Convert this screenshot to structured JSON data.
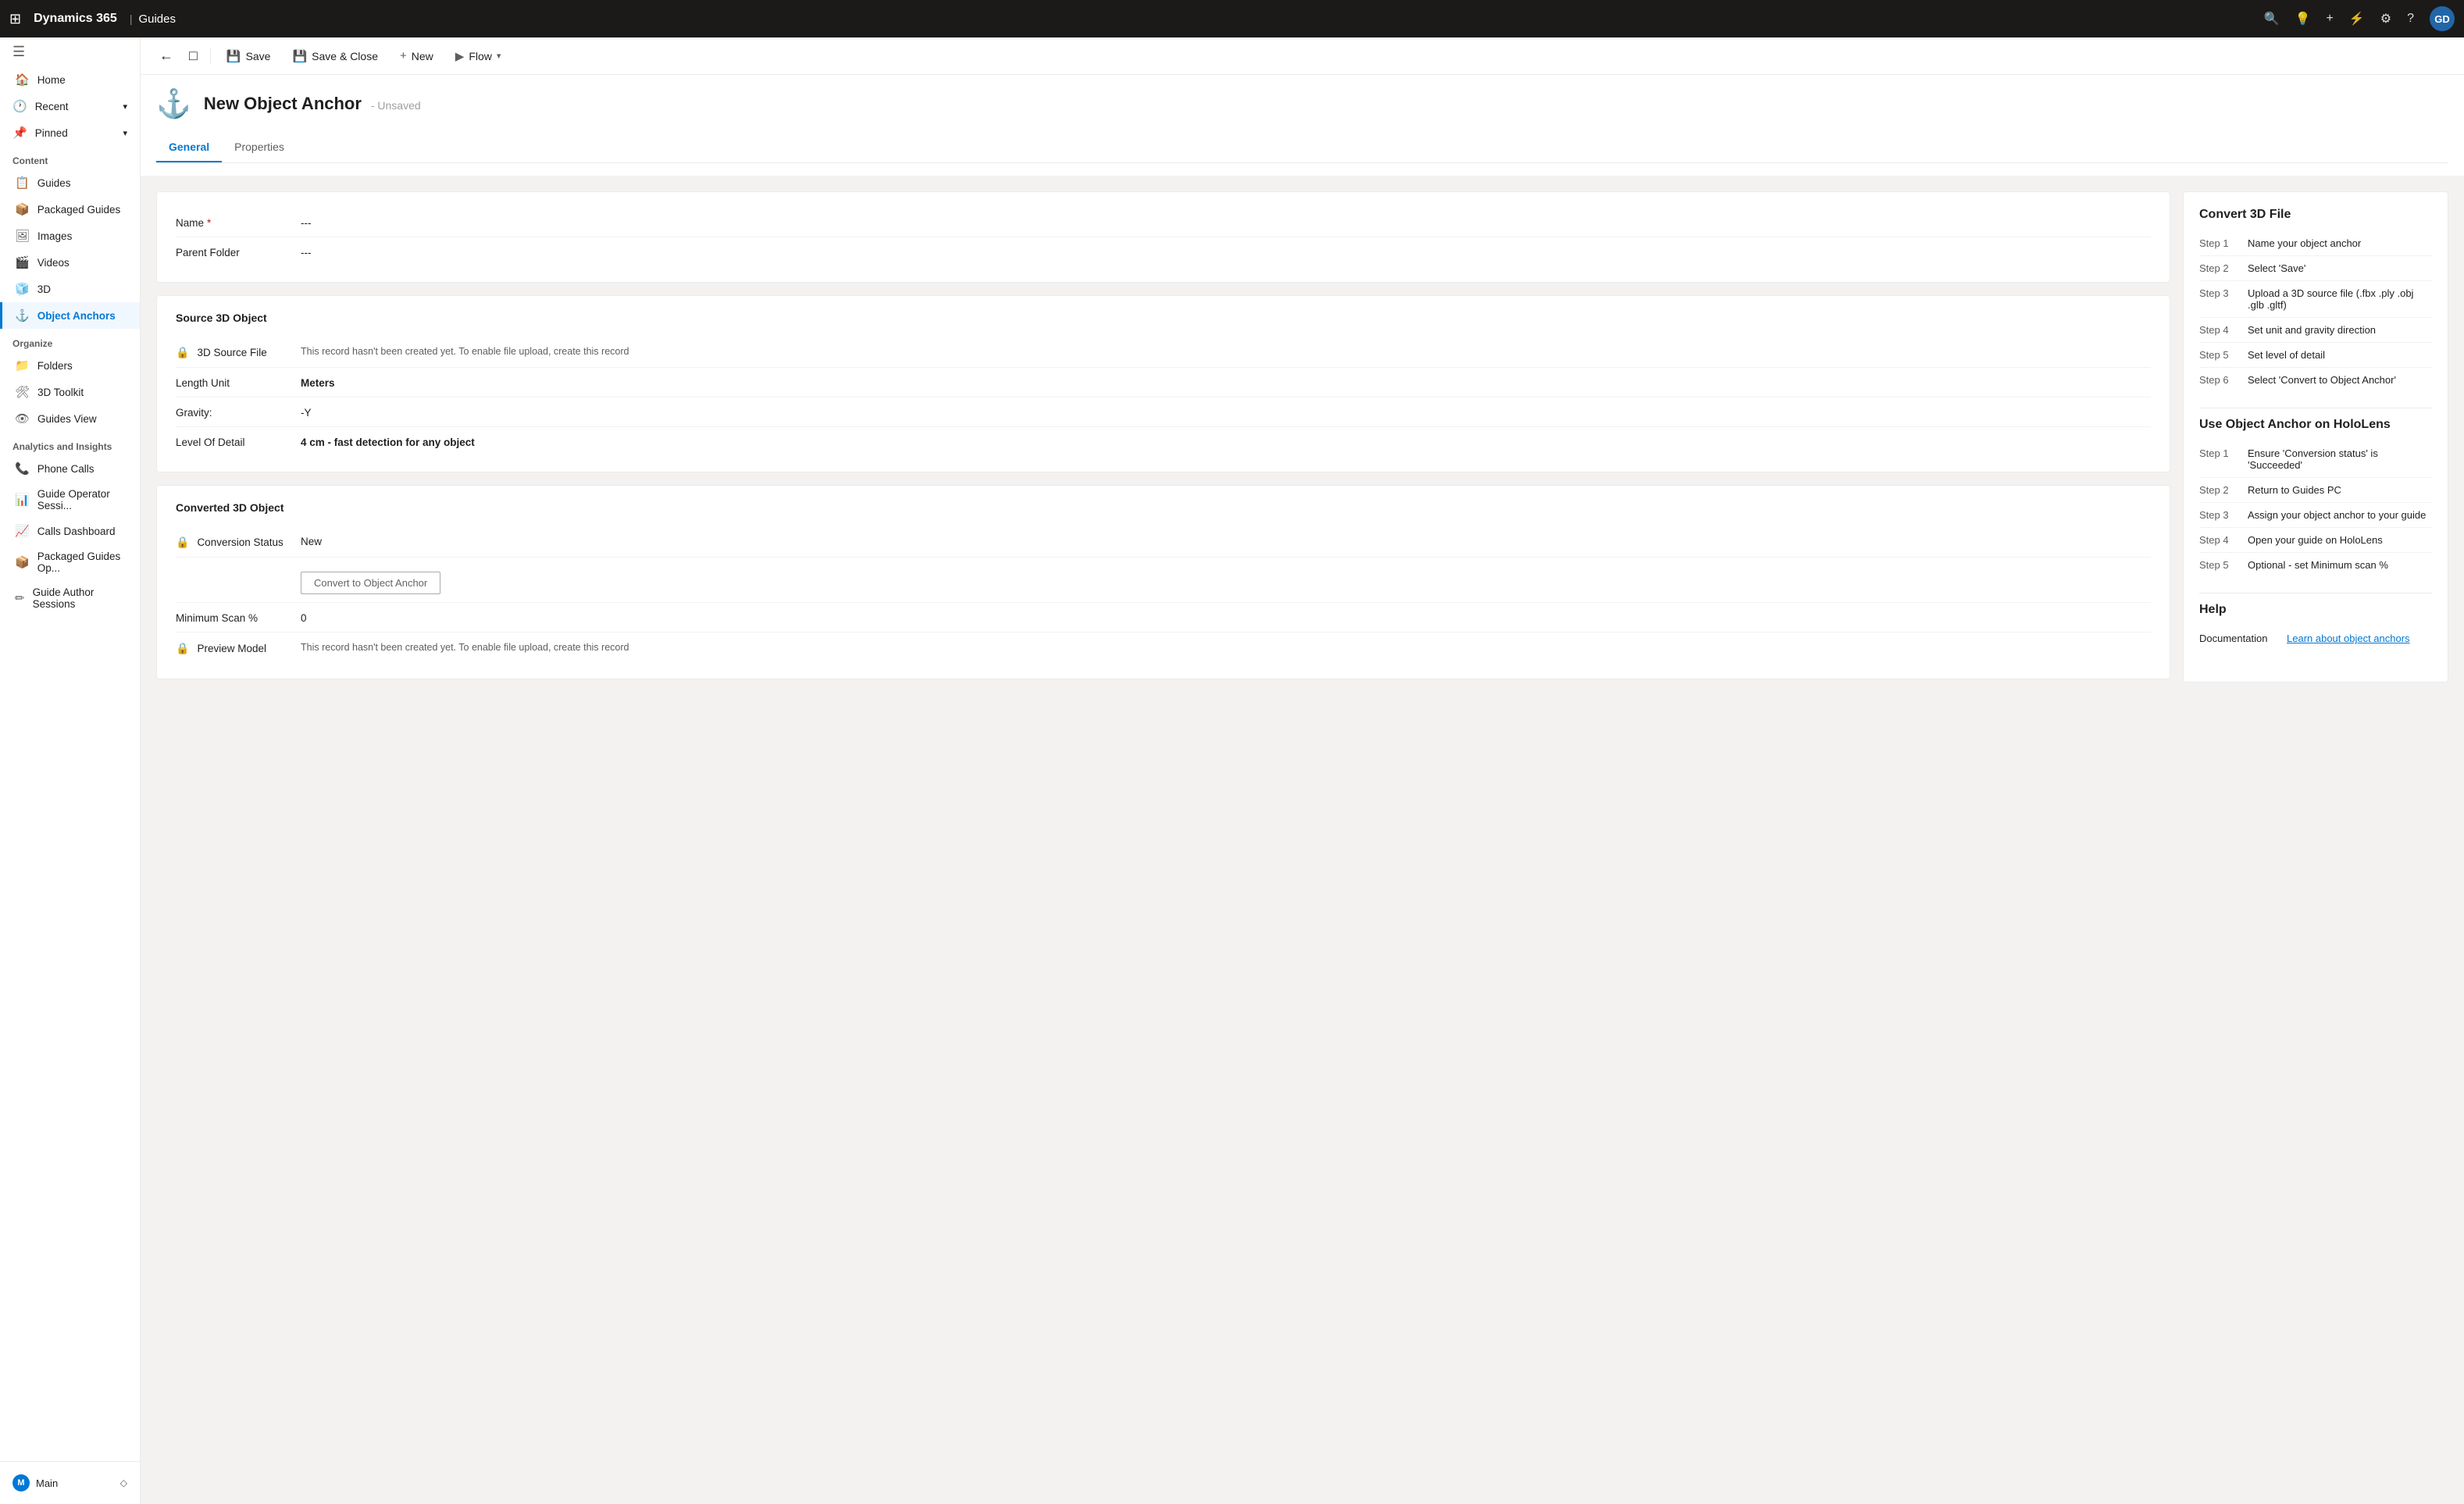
{
  "topNav": {
    "appTitle": "Dynamics 365",
    "divider": "|",
    "appName": "Guides",
    "icons": {
      "grid": "⊞",
      "search": "🔍",
      "bulb": "💡",
      "plus": "+",
      "filter": "⚡",
      "settings": "⚙",
      "help": "?",
      "avatar": "GD"
    }
  },
  "sidebar": {
    "toggleIcon": "☰",
    "items": [
      {
        "id": "home",
        "label": "Home",
        "icon": "🏠"
      },
      {
        "id": "recent",
        "label": "Recent",
        "icon": "🕐",
        "hasChevron": true
      },
      {
        "id": "pinned",
        "label": "Pinned",
        "icon": "📌",
        "hasChevron": true
      }
    ],
    "contentSection": {
      "title": "Content",
      "items": [
        {
          "id": "guides",
          "label": "Guides",
          "icon": "📋"
        },
        {
          "id": "packaged-guides",
          "label": "Packaged Guides",
          "icon": "📦"
        },
        {
          "id": "images",
          "label": "Images",
          "icon": "🖼"
        },
        {
          "id": "videos",
          "label": "Videos",
          "icon": "🎬"
        },
        {
          "id": "3d",
          "label": "3D",
          "icon": "🧊"
        },
        {
          "id": "object-anchors",
          "label": "Object Anchors",
          "icon": "⚓",
          "active": true
        }
      ]
    },
    "organizeSection": {
      "title": "Organize",
      "items": [
        {
          "id": "folders",
          "label": "Folders",
          "icon": "📁"
        },
        {
          "id": "3d-toolkit",
          "label": "3D Toolkit",
          "icon": "🛠"
        },
        {
          "id": "guides-view",
          "label": "Guides View",
          "icon": "👁"
        }
      ]
    },
    "analyticsSection": {
      "title": "Analytics and Insights",
      "items": [
        {
          "id": "phone-calls",
          "label": "Phone Calls",
          "icon": "📞"
        },
        {
          "id": "guide-operator",
          "label": "Guide Operator Sessi...",
          "icon": "📊"
        },
        {
          "id": "calls-dashboard",
          "label": "Calls Dashboard",
          "icon": "📈"
        },
        {
          "id": "packaged-guides-op",
          "label": "Packaged Guides Op...",
          "icon": "📦"
        },
        {
          "id": "guide-author",
          "label": "Guide Author Sessions",
          "icon": "✏"
        }
      ]
    },
    "footer": {
      "label": "Main",
      "icon": "M",
      "chevron": "◇"
    }
  },
  "commandBar": {
    "backIcon": "←",
    "forwardIcon": "□",
    "buttons": [
      {
        "id": "save",
        "label": "Save",
        "icon": "💾"
      },
      {
        "id": "save-close",
        "label": "Save & Close",
        "icon": "💾"
      },
      {
        "id": "new",
        "label": "New",
        "icon": "+"
      },
      {
        "id": "flow",
        "label": "Flow",
        "icon": "▶",
        "hasDropdown": true
      }
    ]
  },
  "record": {
    "icon": "⚓",
    "title": "New Object Anchor",
    "status": "- Unsaved"
  },
  "tabs": [
    {
      "id": "general",
      "label": "General",
      "active": true
    },
    {
      "id": "properties",
      "label": "Properties"
    }
  ],
  "form": {
    "basicSection": {
      "rows": [
        {
          "id": "name",
          "label": "Name",
          "required": true,
          "value": "---"
        },
        {
          "id": "parent-folder",
          "label": "Parent Folder",
          "value": "---"
        }
      ]
    },
    "source3dSection": {
      "title": "Source 3D Object",
      "rows": [
        {
          "id": "3d-source-file",
          "label": "3D Source File",
          "locked": true,
          "value": "This record hasn't been created yet. To enable file upload, create this record"
        },
        {
          "id": "length-unit",
          "label": "Length Unit",
          "value": "Meters",
          "bold": true
        },
        {
          "id": "gravity",
          "label": "Gravity:",
          "value": "-Y"
        },
        {
          "id": "level-of-detail",
          "label": "Level Of Detail",
          "value": "4 cm - fast detection for any object",
          "bold": true
        }
      ]
    },
    "converted3dSection": {
      "title": "Converted 3D Object",
      "rows": [
        {
          "id": "conversion-status",
          "label": "Conversion Status",
          "locked": true,
          "value": "New"
        },
        {
          "id": "convert-btn",
          "label": "",
          "buttonLabel": "Convert to Object Anchor"
        },
        {
          "id": "minimum-scan",
          "label": "Minimum Scan %",
          "value": "0"
        },
        {
          "id": "preview-model",
          "label": "Preview Model",
          "locked": true,
          "value": "This record hasn't been created yet. To enable file upload, create this record"
        }
      ]
    }
  },
  "rightPanel": {
    "convert3dSection": {
      "title": "Convert 3D File",
      "steps": [
        {
          "label": "Step 1",
          "desc": "Name your object anchor"
        },
        {
          "label": "Step 2",
          "desc": "Select 'Save'"
        },
        {
          "label": "Step 3",
          "desc": "Upload a 3D source file (.fbx .ply .obj .glb .gltf)"
        },
        {
          "label": "Step 4",
          "desc": "Set unit and gravity direction"
        },
        {
          "label": "Step 5",
          "desc": "Set level of detail"
        },
        {
          "label": "Step 6",
          "desc": "Select 'Convert to Object Anchor'"
        }
      ]
    },
    "holoLensSection": {
      "title": "Use Object Anchor on HoloLens",
      "steps": [
        {
          "label": "Step 1",
          "desc": "Ensure 'Conversion status' is 'Succeeded'"
        },
        {
          "label": "Step 2",
          "desc": "Return to Guides PC"
        },
        {
          "label": "Step 3",
          "desc": "Assign your object anchor to your guide"
        },
        {
          "label": "Step 4",
          "desc": "Open your guide on HoloLens"
        },
        {
          "label": "Step 5",
          "desc": "Optional - set Minimum scan %"
        }
      ]
    },
    "helpSection": {
      "title": "Help",
      "docLabel": "Documentation",
      "docLinkLabel": "Learn about object anchors"
    }
  }
}
